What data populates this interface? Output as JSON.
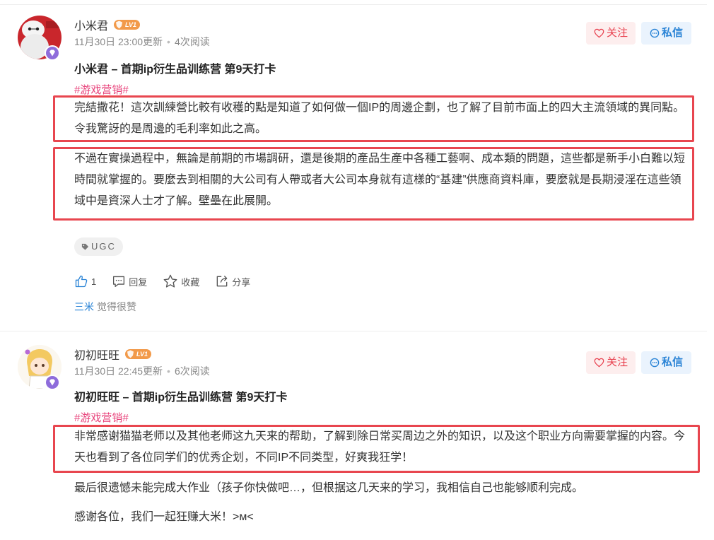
{
  "posts": [
    {
      "username": "小米君",
      "level": "LV1",
      "time": "11月30日 23:00更新",
      "reads": "4次阅读",
      "follow_label": "关注",
      "message_label": "私信",
      "title": "小米君 – 首期ip衍生品训练营 第9天打卡",
      "tag": "#游戏营销#",
      "paragraphs": [
        "完結撒花！這次訓練營比較有收穫的點是知道了如何做一個IP的周邊企劃，也了解了目前市面上的四大主流領域的異同點。令我驚訝的是周邊的毛利率如此之高。",
        "不過在實操過程中，無論是前期的市場調研，還是後期的產品生產中各種工藝啊、成本類的問題，這些都是新手小白難以短時間就掌握的。要麼去到相關的大公司有人帶或者大公司本身就有這樣的“基建”供應商資料庫，要麼就是長期浸淫在這些領域中是資深人士才了解。壁壘在此展開。"
      ],
      "topic_tag": "UGC",
      "like_count": "1",
      "reply_label": "回复",
      "collect_label": "收藏",
      "share_label": "分享",
      "liked_by": "三米",
      "liked_suffix": "觉得很赞"
    },
    {
      "username": "初初旺旺",
      "level": "LV1",
      "time": "11月30日 22:45更新",
      "reads": "6次阅读",
      "follow_label": "关注",
      "message_label": "私信",
      "title": "初初旺旺 – 首期ip衍生品训练营 第9天打卡",
      "tag": "#游戏营销#",
      "paragraphs": [
        "非常感谢猫猫老师以及其他老师这九天来的帮助，了解到除日常买周边之外的知识，以及这个职业方向需要掌握的内容。今天也看到了各位同学们的优秀企划，不同IP不同类型，好爽我狂学！",
        "最后很遗憾未能完成大作业（孩子你快做吧…，但根据这几天来的学习，我相信自己也能够顺利完成。",
        "感谢各位，我们一起狂赚大米！>м<"
      ]
    }
  ],
  "colors": {
    "highlight_border": "#e8464f",
    "tag": "#e8417a",
    "follow": "#e8414f",
    "message": "#2b84d6",
    "level_badge": "#f29a4a",
    "avatar_badge": "#8e6cdb"
  }
}
